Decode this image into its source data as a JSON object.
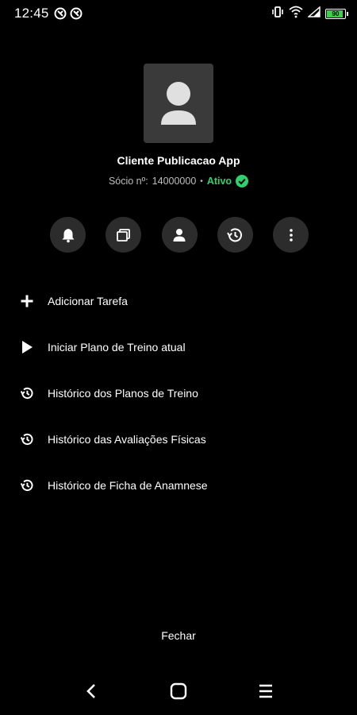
{
  "status_bar": {
    "time": "12:45",
    "battery_level": 0.9,
    "battery_text": "90"
  },
  "profile": {
    "name": "Cliente Publicacao App",
    "member_label": "Sócio nº:",
    "member_number": "14000000",
    "separator": "•",
    "status": "Ativo",
    "status_color": "#2fd06d"
  },
  "actions": [
    {
      "icon": "bell-icon"
    },
    {
      "icon": "cards-icon"
    },
    {
      "icon": "person-icon"
    },
    {
      "icon": "history-icon"
    },
    {
      "icon": "more-vertical-icon"
    }
  ],
  "menu": {
    "items": [
      {
        "label": "Adicionar Tarefa",
        "icon": "plus-icon"
      },
      {
        "label": "Iniciar Plano de Treino atual",
        "icon": "play-icon"
      },
      {
        "label": "Histórico dos Planos de Treino",
        "icon": "history-icon"
      },
      {
        "label": "Histórico das Avaliações Físicas",
        "icon": "history-icon"
      },
      {
        "label": "Histórico de Ficha de Anamnese",
        "icon": "history-icon"
      }
    ]
  },
  "close_label": "Fechar",
  "colors": {
    "background": "#000000",
    "surface": "#2c2c2c",
    "accent_green": "#2fd06d"
  }
}
